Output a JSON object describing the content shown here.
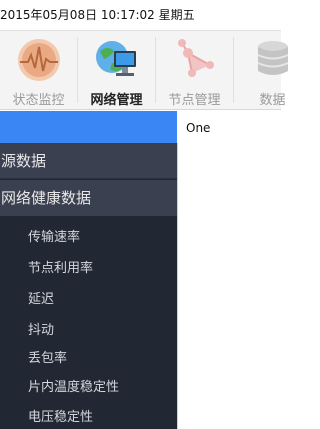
{
  "header": {
    "datetime": "2015年05月08日 10:17:02 星期五"
  },
  "toolbar": {
    "items": [
      {
        "label": "状态监控",
        "icon": "heartbeat-monitor-icon",
        "active": false
      },
      {
        "label": "网络管理",
        "icon": "globe-computer-icon",
        "active": true
      },
      {
        "label": "节点管理",
        "icon": "node-network-icon",
        "active": false
      },
      {
        "label": "数据",
        "icon": "database-icon",
        "active": false
      }
    ]
  },
  "content": {
    "tab_label": "One"
  },
  "sidebar": {
    "categories": [
      "源数据",
      "网络健康数据"
    ],
    "items": [
      "传输速率",
      "节点利用率",
      "延迟",
      "抖动",
      "丢包率",
      "片内温度稳定性",
      "电压稳定性"
    ]
  },
  "colors": {
    "accent": "#3b86f5",
    "sidebar_bg": "#222833",
    "category_bg": "#3a4050"
  }
}
